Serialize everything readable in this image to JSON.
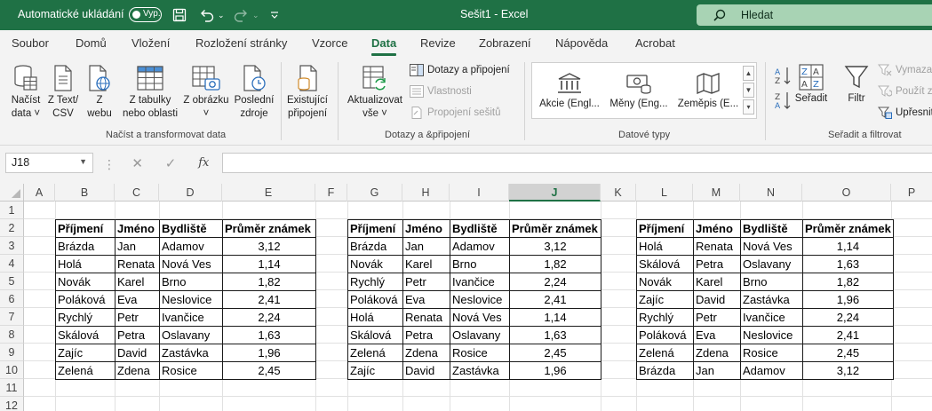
{
  "titlebar": {
    "autosave_label": "Automatické ukládání",
    "autosave_state": "Vyp.",
    "doc_title": "Sešit1  -  Excel",
    "search_placeholder": "Hledat"
  },
  "tabs": [
    {
      "label": "Soubor"
    },
    {
      "label": "Domů"
    },
    {
      "label": "Vložení"
    },
    {
      "label": "Rozložení stránky"
    },
    {
      "label": "Vzorce"
    },
    {
      "label": "Data",
      "active": true
    },
    {
      "label": "Revize"
    },
    {
      "label": "Zobrazení"
    },
    {
      "label": "Nápověda"
    },
    {
      "label": "Acrobat"
    }
  ],
  "ribbon": {
    "get_data": {
      "nacist_data_1": "Načíst",
      "nacist_data_2": "data ˅",
      "text_csv_1": "Z Text/",
      "text_csv_2": "CSV",
      "web_1": "Z",
      "web_2": "webu",
      "table_1": "Z tabulky",
      "table_2": "nebo oblasti",
      "picture_1": "Z obrázku",
      "picture_2": "˅",
      "recent_1": "Poslední",
      "recent_2": "zdroje",
      "existing_1": "Existující",
      "existing_2": "připojení",
      "group_label": "Načíst a transformovat data"
    },
    "queries": {
      "refresh_1": "Aktualizovat",
      "refresh_2": "vše ˅",
      "queries_connections": "Dotazy a připojení",
      "properties": "Vlastnosti",
      "workbook_links": "Propojení sešitů",
      "group_label": "Dotazy a &připojení"
    },
    "data_types": {
      "stocks": "Akcie (Engl...",
      "currencies": "Měny (Eng...",
      "geography": "Zeměpis (E...",
      "group_label": "Datové typy"
    },
    "sort_filter": {
      "sort": "Seřadit",
      "filter": "Filtr",
      "clear": "Vymazat",
      "reapply": "Použít z",
      "advanced": "Upřesnit",
      "group_label": "Seřadit a filtrovat"
    }
  },
  "formula_bar": {
    "name_box": "J18",
    "fx": "fx",
    "formula": ""
  },
  "grid": {
    "columns": [
      "A",
      "B",
      "C",
      "D",
      "E",
      "F",
      "G",
      "H",
      "I",
      "J",
      "K",
      "L",
      "M",
      "N",
      "O",
      "P"
    ],
    "selected_column": "J",
    "rows": [
      "1",
      "2",
      "3",
      "4",
      "5",
      "6",
      "7",
      "8",
      "9",
      "10",
      "11",
      "12"
    ]
  },
  "tables": [
    {
      "headers": [
        "Příjmení",
        "Jméno",
        "Bydliště",
        "Průměr známek"
      ],
      "rows": [
        [
          "Brázda",
          "Jan",
          "Adamov",
          "3,12"
        ],
        [
          "Holá",
          "Renata",
          "Nová Ves",
          "1,14"
        ],
        [
          "Novák",
          "Karel",
          "Brno",
          "1,82"
        ],
        [
          "Poláková",
          "Eva",
          "Neslovice",
          "2,41"
        ],
        [
          "Rychlý",
          "Petr",
          "Ivančice",
          "2,24"
        ],
        [
          "Skálová",
          "Petra",
          "Oslavany",
          "1,63"
        ],
        [
          "Zajíc",
          "David",
          "Zastávka",
          "1,96"
        ],
        [
          "Zelená",
          "Zdena",
          "Rosice",
          "2,45"
        ]
      ]
    },
    {
      "headers": [
        "Příjmení",
        "Jméno",
        "Bydliště",
        "Průměr známek"
      ],
      "rows": [
        [
          "Brázda",
          "Jan",
          "Adamov",
          "3,12"
        ],
        [
          "Novák",
          "Karel",
          "Brno",
          "1,82"
        ],
        [
          "Rychlý",
          "Petr",
          "Ivančice",
          "2,24"
        ],
        [
          "Poláková",
          "Eva",
          "Neslovice",
          "2,41"
        ],
        [
          "Holá",
          "Renata",
          "Nová Ves",
          "1,14"
        ],
        [
          "Skálová",
          "Petra",
          "Oslavany",
          "1,63"
        ],
        [
          "Zelená",
          "Zdena",
          "Rosice",
          "2,45"
        ],
        [
          "Zajíc",
          "David",
          "Zastávka",
          "1,96"
        ]
      ]
    },
    {
      "headers": [
        "Příjmení",
        "Jméno",
        "Bydliště",
        "Průměr známek"
      ],
      "rows": [
        [
          "Holá",
          "Renata",
          "Nová Ves",
          "1,14"
        ],
        [
          "Skálová",
          "Petra",
          "Oslavany",
          "1,63"
        ],
        [
          "Novák",
          "Karel",
          "Brno",
          "1,82"
        ],
        [
          "Zajíc",
          "David",
          "Zastávka",
          "1,96"
        ],
        [
          "Rychlý",
          "Petr",
          "Ivančice",
          "2,24"
        ],
        [
          "Poláková",
          "Eva",
          "Neslovice",
          "2,41"
        ],
        [
          "Zelená",
          "Zdena",
          "Rosice",
          "2,45"
        ],
        [
          "Brázda",
          "Jan",
          "Adamov",
          "3,12"
        ]
      ]
    }
  ],
  "colors": {
    "excel_green": "#1f7145",
    "search_bg": "#a8d3b4",
    "ribbon_bg": "#f3f3f3"
  }
}
